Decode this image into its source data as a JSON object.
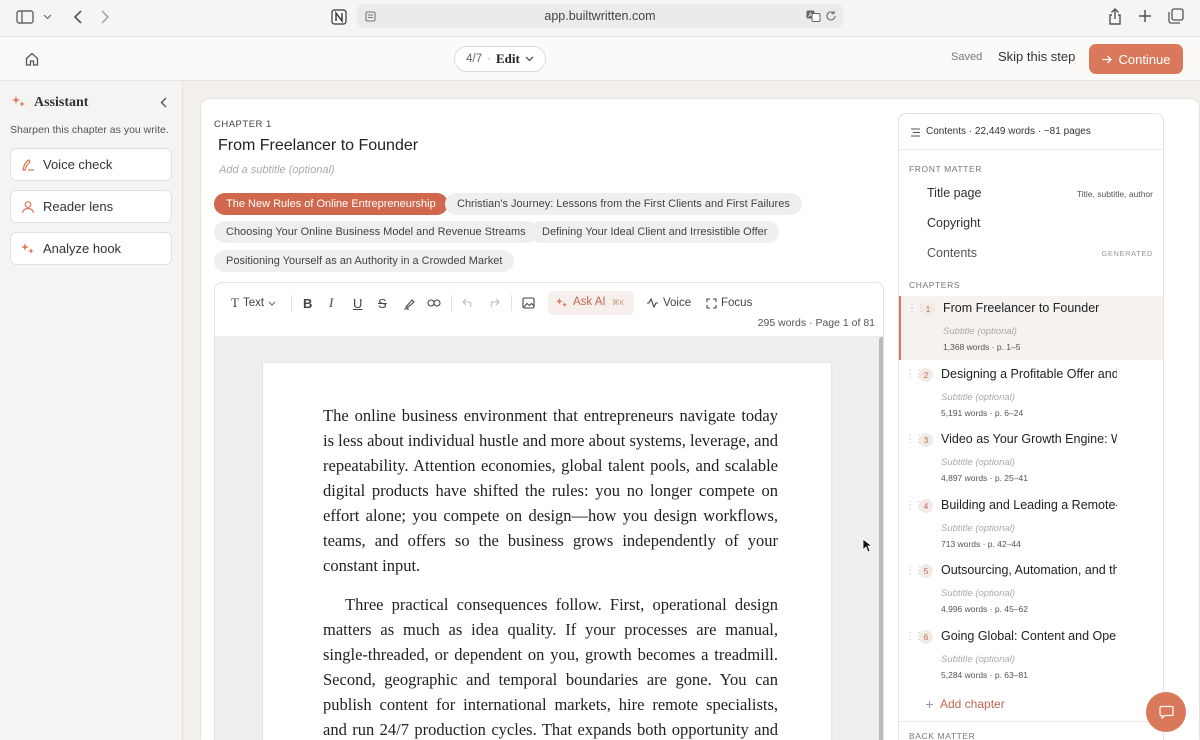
{
  "browser": {
    "url": "app.builtwritten.com"
  },
  "header": {
    "step": "4/7",
    "step_sep": "·",
    "mode": "Edit",
    "saved": "Saved",
    "skip": "Skip this step",
    "continue": "Continue",
    "accent": "#d9785a"
  },
  "assistant": {
    "title": "Assistant",
    "subtitle": "Sharpen this chapter as you write.",
    "buttons": [
      {
        "label": "Voice check",
        "icon": "voice-check-icon"
      },
      {
        "label": "Reader lens",
        "icon": "user-icon"
      },
      {
        "label": "Analyze hook",
        "icon": "sparkle-icon"
      }
    ]
  },
  "chapter": {
    "label": "CHAPTER 1",
    "title": "From Freelancer to Founder",
    "subtitle_placeholder": "Add a subtitle (optional)",
    "sections": [
      "The New Rules of Online Entrepreneurship",
      "Christian's Journey: Lessons from the First Clients and First Failures",
      "Choosing Your Online Business Model and Revenue Streams",
      "Defining Your Ideal Client and Irresistible Offer",
      "Positioning Yourself as an Authority in a Crowded Market"
    ]
  },
  "toolbar": {
    "text": "Text",
    "ask_ai": "Ask AI",
    "ask_ai_shortcut": "⌘K",
    "voice": "Voice",
    "focus": "Focus",
    "status": "295 words · Page 1 of 81"
  },
  "document": {
    "paragraphs": [
      "The online business environment that entrepreneurs navigate today is less about individual hustle and more about systems, leverage, and repeatability. Attention economies, global talent pools, and scalable digital products have shifted the rules: you no longer compete on effort alone; you compete on design—how you design workflows, teams, and offers so the business grows independently of your constant input.",
      "Three practical consequences follow. First, operational design matters as much as idea quality. If your processes are manual, single-threaded, or dependent on you, growth becomes a treadmill. Second, geographic and temporal boundaries are gone. You can publish content for international markets, hire remote specialists, and run 24/7 production cycles. That expands both opportunity and complexity:"
    ]
  },
  "contents": {
    "header": "Contents · 22,449 words · ~81 pages",
    "front_matter_label": "FRONT MATTER",
    "front_matter": [
      {
        "label": "Title page",
        "meta": "Title, subtitle, author"
      },
      {
        "label": "Copyright",
        "meta": ""
      },
      {
        "label": "Contents",
        "meta": "GENERATED"
      }
    ],
    "chapters_label": "CHAPTERS",
    "chapters": [
      {
        "num": "1",
        "title": "From Freelancer to Founder",
        "subtitle": "Subtitle (optional)",
        "meta": "1,368 words · p. 1–5"
      },
      {
        "num": "2",
        "title": "Designing a Profitable Offer and",
        "subtitle": "Subtitle (optional)",
        "meta": "5,191 words · p. 6–24"
      },
      {
        "num": "3",
        "title": "Video as Your Growth Engine: W",
        "subtitle": "Subtitle (optional)",
        "meta": "4,897 words · p. 25–41"
      },
      {
        "num": "4",
        "title": "Building and Leading a Remote-",
        "subtitle": "Subtitle (optional)",
        "meta": "713 words · p. 42–44"
      },
      {
        "num": "5",
        "title": "Outsourcing, Automation, and th",
        "subtitle": "Subtitle (optional)",
        "meta": "4,996 words · p. 45–62"
      },
      {
        "num": "6",
        "title": "Going Global: Content and Oper",
        "subtitle": "Subtitle (optional)",
        "meta": "5,284 words · p. 63–81"
      }
    ],
    "add_chapter": "Add chapter",
    "back_matter_label": "BACK MATTER"
  }
}
